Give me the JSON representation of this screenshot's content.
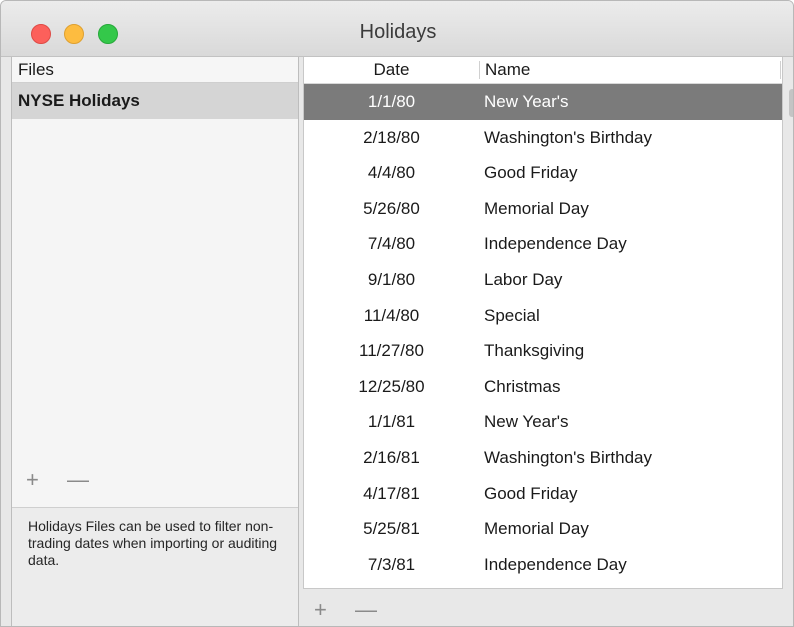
{
  "window": {
    "title": "Holidays"
  },
  "files_panel": {
    "header": "Files",
    "items": [
      "NYSE Holidays"
    ],
    "add": "+",
    "remove": "—",
    "help": "Holidays Files can be used to filter non-trading dates when importing or auditing data."
  },
  "table": {
    "headers": {
      "date": "Date",
      "name": "Name"
    },
    "rows": [
      {
        "date": "1/1/80",
        "name": "New Year's"
      },
      {
        "date": "2/18/80",
        "name": "Washington's Birthday"
      },
      {
        "date": "4/4/80",
        "name": "Good Friday"
      },
      {
        "date": "5/26/80",
        "name": "Memorial Day"
      },
      {
        "date": "7/4/80",
        "name": "Independence Day"
      },
      {
        "date": "9/1/80",
        "name": "Labor Day"
      },
      {
        "date": "11/4/80",
        "name": "Special"
      },
      {
        "date": "11/27/80",
        "name": "Thanksgiving"
      },
      {
        "date": "12/25/80",
        "name": "Christmas"
      },
      {
        "date": "1/1/81",
        "name": "New Year's"
      },
      {
        "date": "2/16/81",
        "name": "Washington's Birthday"
      },
      {
        "date": "4/17/81",
        "name": "Good Friday"
      },
      {
        "date": "5/25/81",
        "name": "Memorial Day"
      },
      {
        "date": "7/3/81",
        "name": "Independence Day"
      }
    ],
    "add": "+",
    "remove": "—"
  }
}
